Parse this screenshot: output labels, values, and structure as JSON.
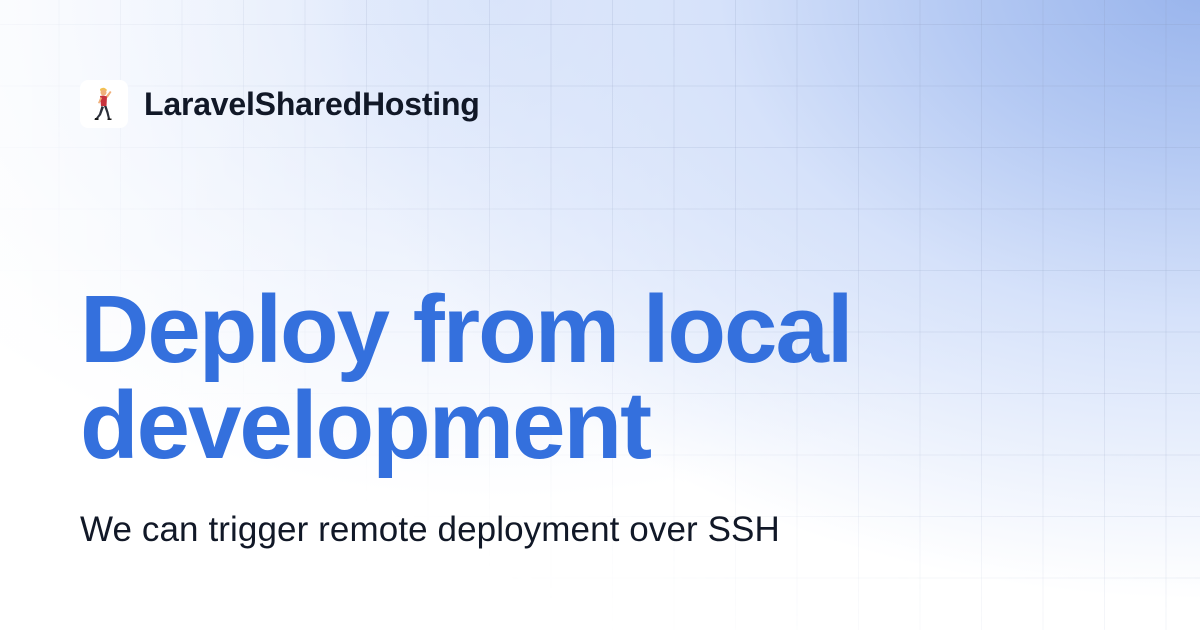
{
  "brand": {
    "name": "LaravelSharedHosting",
    "logo_icon": "person-walking-icon"
  },
  "headline": {
    "line1": "Deploy from local",
    "line2": "development"
  },
  "subtitle": "We can trigger remote deployment over SSH",
  "colors": {
    "headline": "#3470dd",
    "text": "#111827",
    "gradient_accent": "#97b3ec"
  }
}
